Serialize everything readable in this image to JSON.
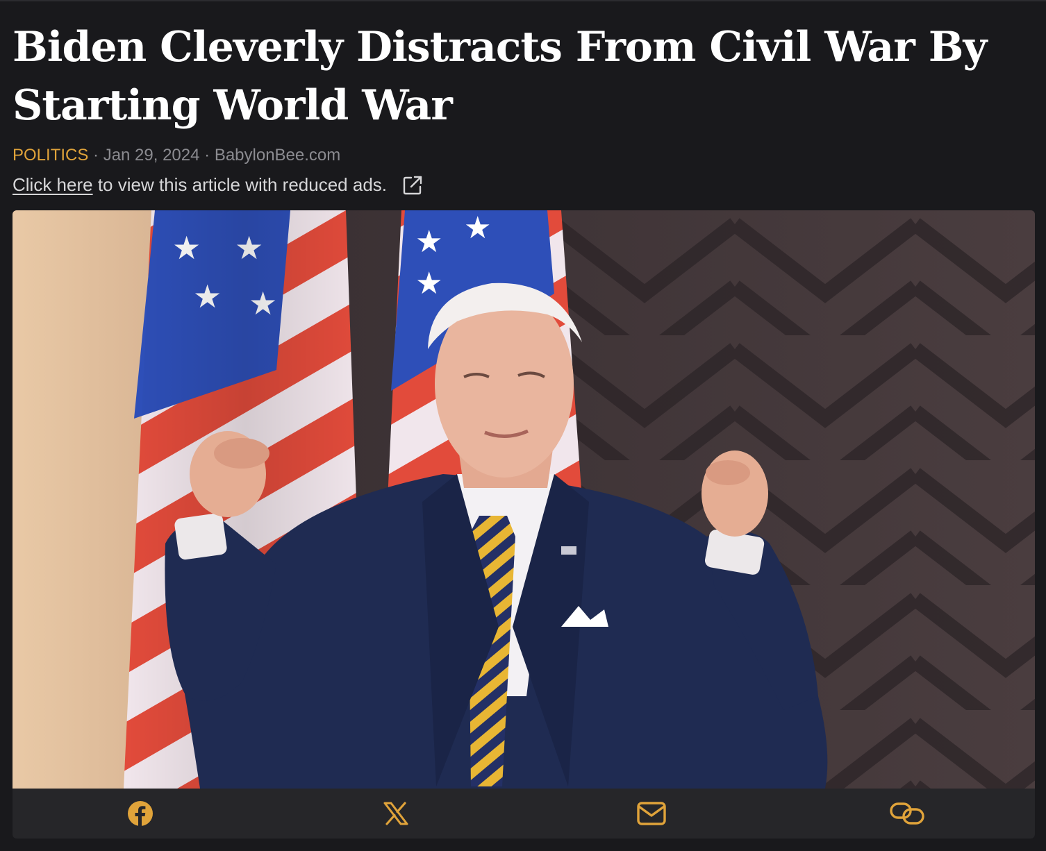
{
  "article": {
    "headline": "Biden Cleverly Distracts From Civil War By Starting World War",
    "category": "POLITICS",
    "separator": " · ",
    "date": "Jan 29, 2024",
    "source": "BabylonBee.com"
  },
  "reduced_ads": {
    "link_label": "Click here",
    "text": " to view this article with reduced ads.",
    "icon": "external-link-icon"
  },
  "hero_image": {
    "icon": "photo-man-in-suit-with-raised-fists-before-us-flags"
  },
  "share_bar": {
    "buttons": [
      {
        "icon": "facebook-icon"
      },
      {
        "icon": "x-icon"
      },
      {
        "icon": "email-icon"
      },
      {
        "icon": "link-icon"
      }
    ]
  },
  "colors": {
    "background": "#19191c",
    "accent": "#e0a33a",
    "headline": "#ffffff",
    "meta": "#8b8b90",
    "share_bar": "#262629"
  }
}
